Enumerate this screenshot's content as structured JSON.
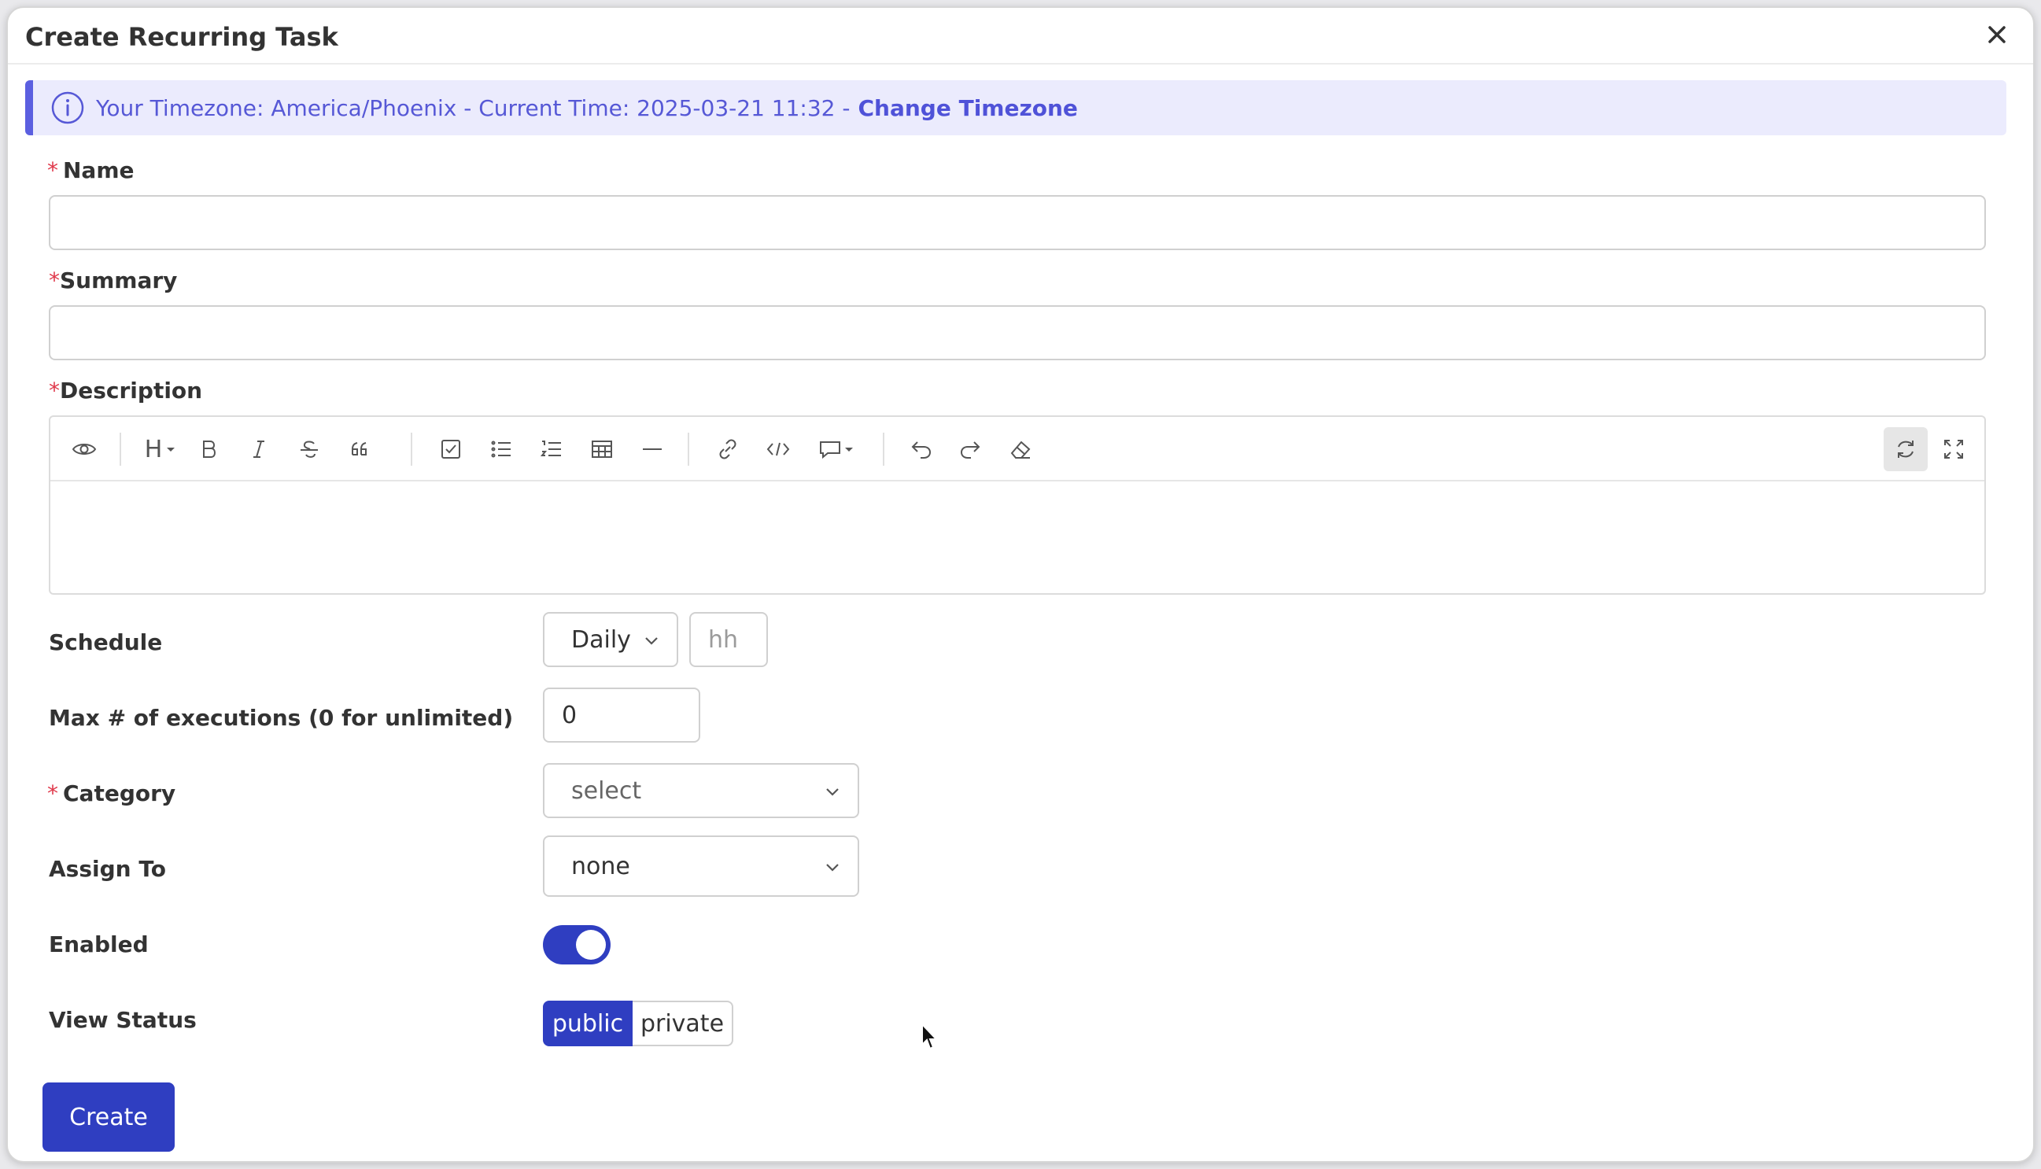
{
  "dialog": {
    "title": "Create Recurring Task"
  },
  "banner": {
    "text": "Your Timezone: America/Phoenix - Current Time: 2025-03-21 11:32 -",
    "link": "Change Timezone"
  },
  "fields": {
    "name_label": "Name",
    "summary_label": "Summary",
    "description_label": "Description",
    "schedule_label": "Schedule",
    "schedule_value": "Daily",
    "hour_placeholder": "hh",
    "max_exec_label": "Max # of executions (0 for unlimited)",
    "max_exec_value": "0",
    "category_label": "Category",
    "category_placeholder": "select",
    "assign_label": "Assign To",
    "assign_value": "none",
    "enabled_label": "Enabled",
    "enabled": true,
    "view_status_label": "View Status",
    "view_status_options": [
      "public",
      "private"
    ],
    "view_status_selected": "public"
  },
  "editor_toolbar": {
    "heading": "H",
    "icons": [
      "eye-icon",
      "heading-icon",
      "bold-icon",
      "italic-icon",
      "strikethrough-icon",
      "quote-icon",
      "checklist-icon",
      "bullet-list-icon",
      "numbered-list-icon",
      "table-icon",
      "horizontal-rule-icon",
      "link-icon",
      "code-icon",
      "comment-icon",
      "undo-icon",
      "redo-icon",
      "eraser-icon",
      "sync-icon",
      "fullscreen-icon"
    ]
  },
  "actions": {
    "create_label": "Create"
  },
  "colors": {
    "primary": "#2f3ec1",
    "banner_bg": "#ebebfd",
    "banner_text": "#5658d6",
    "required": "#e0394b"
  }
}
